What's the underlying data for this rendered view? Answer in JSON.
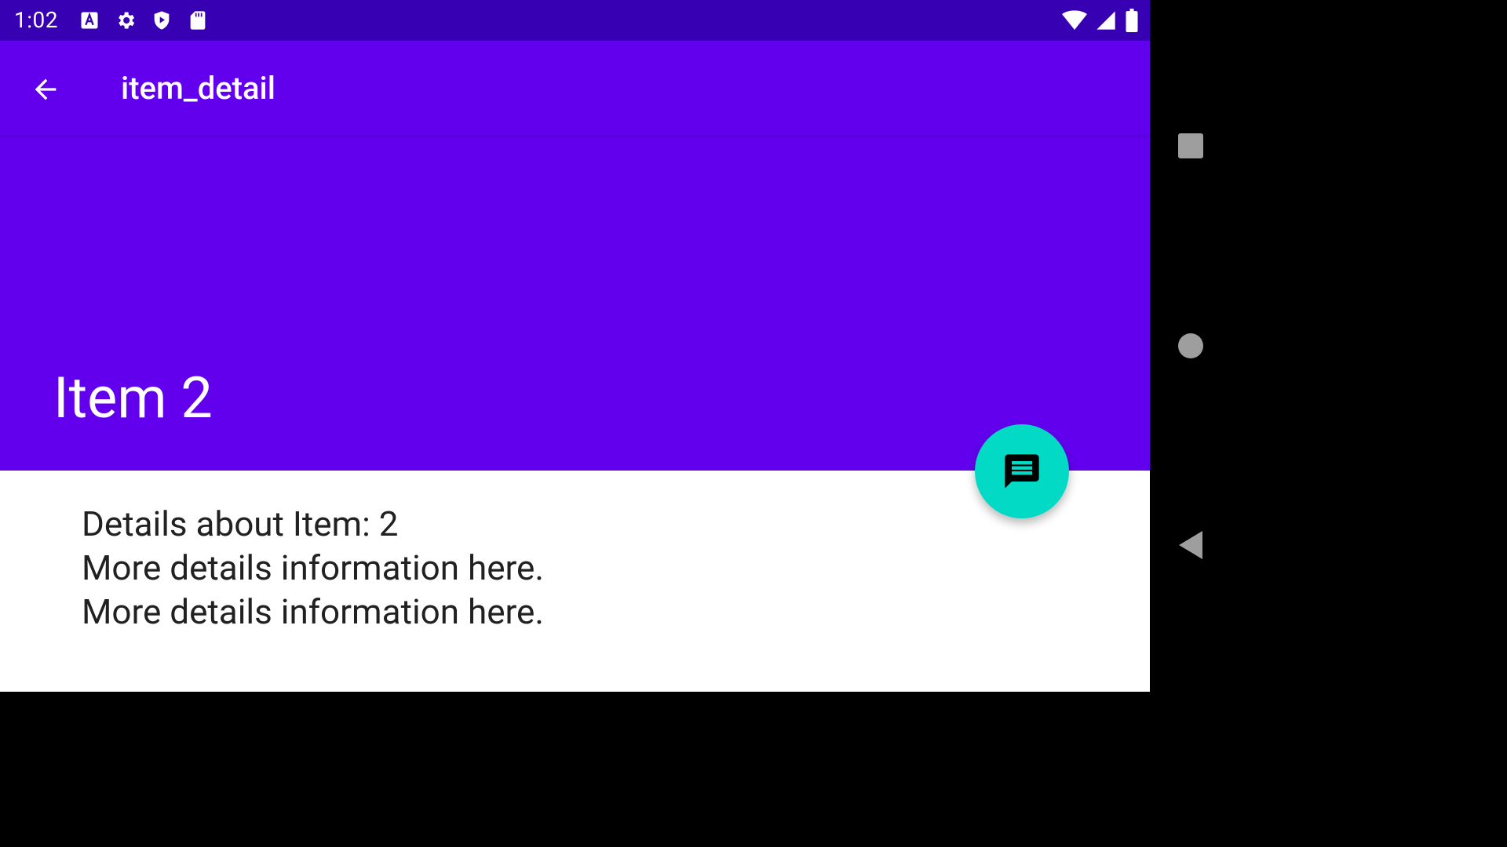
{
  "status_bar": {
    "time": "1:02",
    "left_icons": [
      "font-a-icon",
      "gear-icon",
      "shield-play-icon",
      "sd-card-icon"
    ],
    "right_icons": [
      "wifi-icon",
      "cell-signal-icon",
      "battery-icon"
    ]
  },
  "app_bar": {
    "toolbar_title": "item_detail",
    "expanded_title": "Item 2",
    "color": "#6200ee",
    "status_color": "#3700b3"
  },
  "fab": {
    "icon": "message-icon",
    "color": "#03dac5"
  },
  "content": {
    "lines": [
      "Details about Item: 2",
      "More details information here.",
      "More details information here."
    ]
  },
  "navigation_bar": {
    "buttons": [
      "overview-square-icon",
      "home-circle-icon",
      "back-triangle-icon"
    ]
  }
}
